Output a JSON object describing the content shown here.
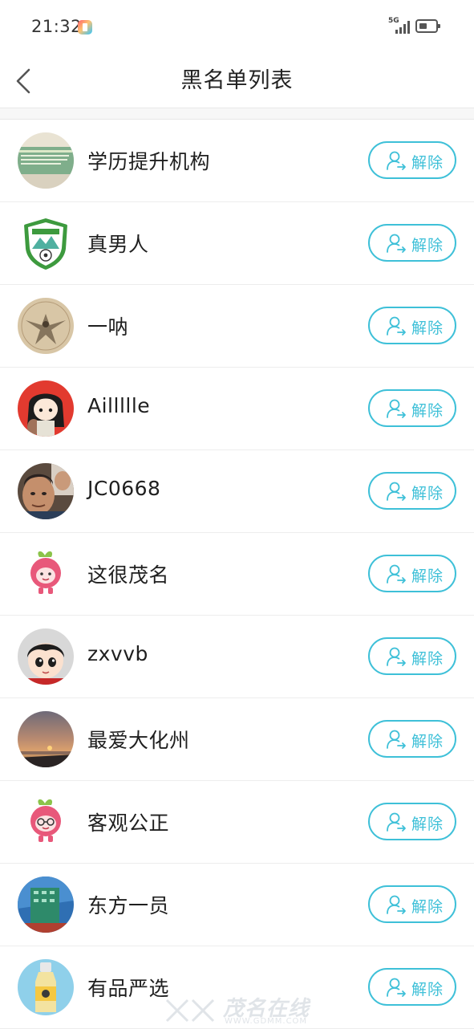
{
  "status_bar": {
    "time": "21:32",
    "network": "5G",
    "icons": [
      "app-notification-icon",
      "signal-icon",
      "battery-icon"
    ]
  },
  "header": {
    "title": "黑名单列表",
    "back_icon": "chevron-left-icon"
  },
  "blacklist": {
    "unblock_label": "解除",
    "unblock_icon": "user-arrow-icon",
    "accent_color": "#3ec0d8",
    "items": [
      {
        "name": "学历提升机构"
      },
      {
        "name": "真男人"
      },
      {
        "name": "一呐"
      },
      {
        "name": "Aillllle"
      },
      {
        "name": "JC0668"
      },
      {
        "name": "这很茂名"
      },
      {
        "name": "zxvvb"
      },
      {
        "name": "最爱大化州"
      },
      {
        "name": "客观公正"
      },
      {
        "name": "东方一员"
      },
      {
        "name": "有品严选"
      }
    ]
  },
  "watermark": {
    "text": "茂名在线",
    "url": "WWW.GDMM.COM"
  }
}
